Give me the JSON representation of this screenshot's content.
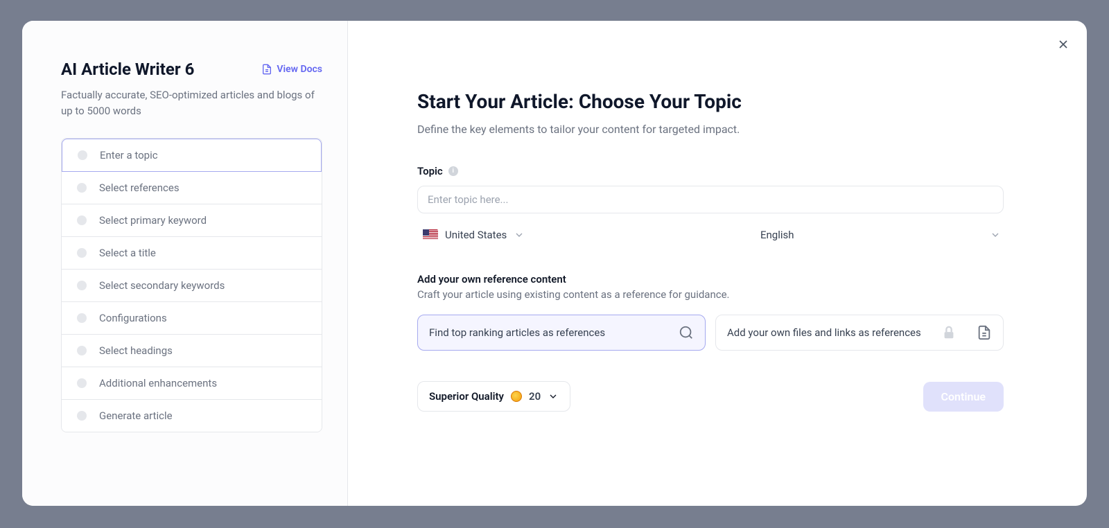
{
  "sidebar": {
    "title": "AI Article Writer 6",
    "viewDocsLabel": "View Docs",
    "subtitle": "Factually accurate, SEO-optimized articles and blogs of up to 5000 words",
    "steps": [
      "Enter a topic",
      "Select references",
      "Select primary keyword",
      "Select a title",
      "Select secondary keywords",
      "Configurations",
      "Select headings",
      "Additional enhancements",
      "Generate article"
    ]
  },
  "main": {
    "title": "Start Your Article: Choose Your Topic",
    "subtitle": "Define the key elements to tailor your content for targeted impact.",
    "topic": {
      "label": "Topic",
      "placeholder": "Enter topic here..."
    },
    "country": "United States",
    "language": "English",
    "reference": {
      "title": "Add your own reference content",
      "subtitle": "Craft your article using existing content as a reference for guidance.",
      "option1": "Find top ranking articles as references",
      "option2": "Add your own files and links as references"
    },
    "quality": {
      "label": "Superior Quality",
      "cost": "20"
    },
    "continueLabel": "Continue"
  }
}
